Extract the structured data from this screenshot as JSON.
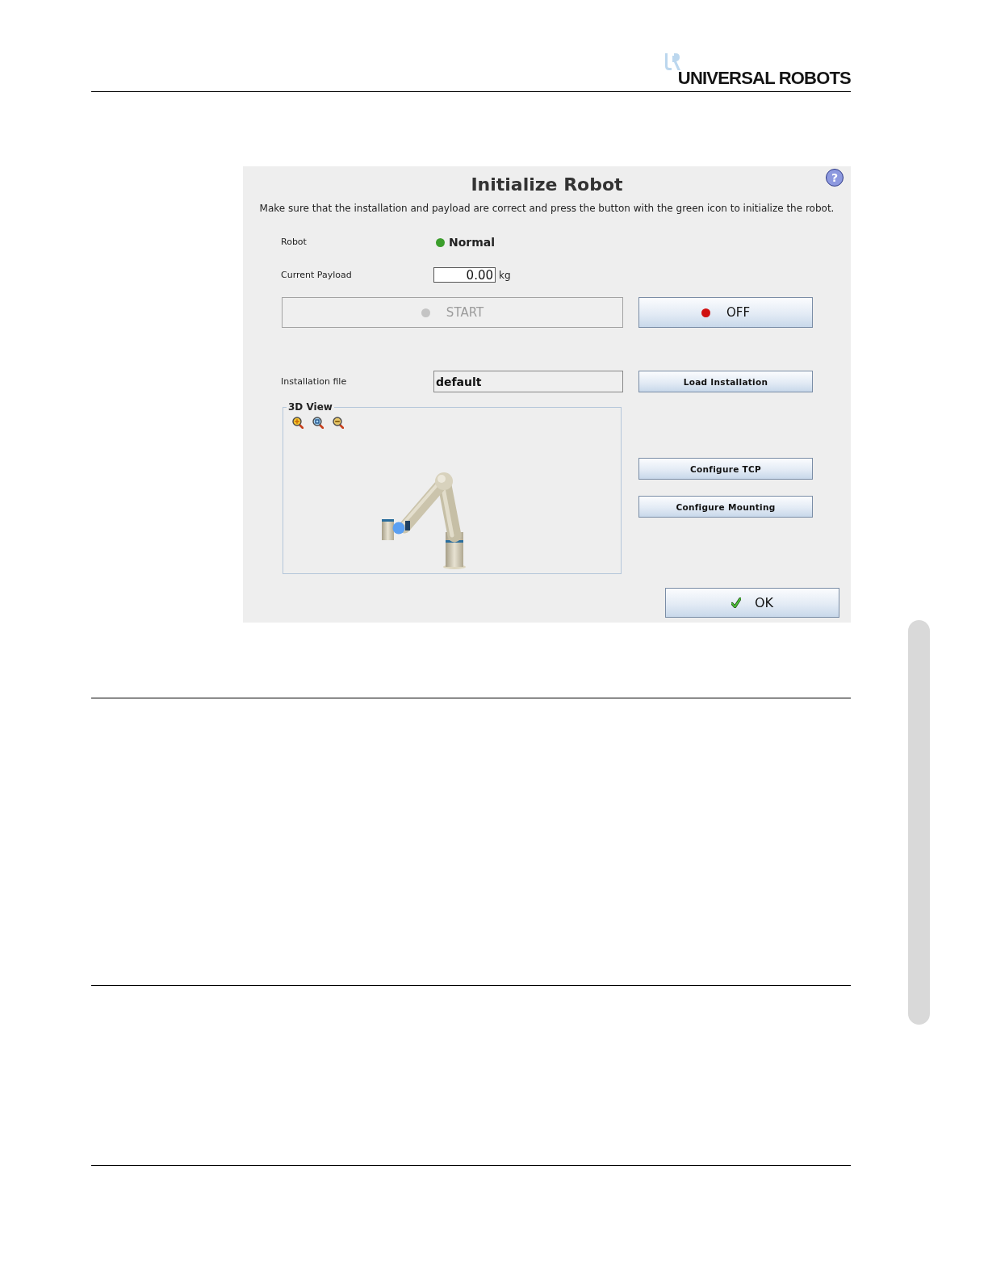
{
  "logo": {
    "wordmark": "UNIVERSAL ROBOTS"
  },
  "dialog": {
    "title": "Initialize Robot",
    "help": {
      "symbol": "?"
    },
    "instructions": "Make sure that the installation and payload are correct and press the button with the green icon to initialize the robot.",
    "robot": {
      "label": "Robot",
      "status": "Normal"
    },
    "payload": {
      "label": "Current Payload",
      "value": "0.00",
      "unit": "kg"
    },
    "power_buttons": [
      {
        "label": "START",
        "disabled": true,
        "color": "#c4c4c4"
      },
      {
        "label": "OFF",
        "disabled": false,
        "color": "#d01010"
      }
    ],
    "installation": {
      "label": "Installation file",
      "value": "default",
      "button": {
        "label": "Load Installation"
      }
    },
    "view_3d": {
      "title": "3D View"
    },
    "side_buttons": [
      {
        "label": "Configure TCP"
      },
      {
        "label": "Configure Mounting"
      }
    ],
    "ok_button": {
      "label": "OK"
    }
  }
}
